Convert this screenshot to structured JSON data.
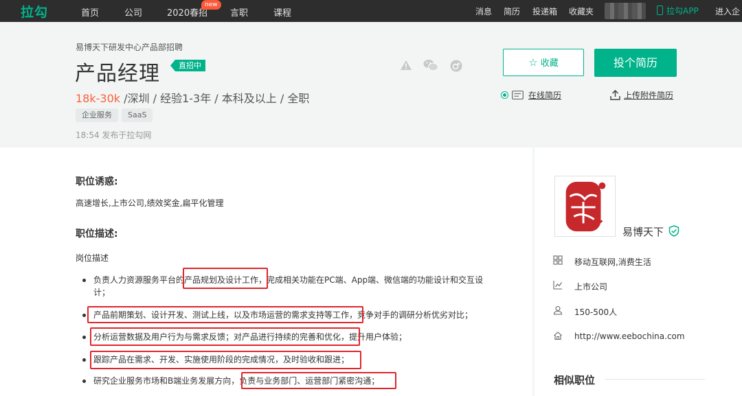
{
  "nav": {
    "logo": "拉勾",
    "items": [
      "首页",
      "公司",
      "2020春招",
      "言职",
      "课程"
    ],
    "new_badge": "new",
    "right_items": [
      "消息",
      "简历",
      "投递箱",
      "收藏夹"
    ],
    "app_label": "拉勾APP",
    "enterprise_label": "进入企"
  },
  "job": {
    "company_dept": "易博天下研发中心产品部招聘",
    "title": "产品经理",
    "badge": "直招中",
    "salary": "18k-30k",
    "meta": " /深圳 / 经验1-3年 / 本科及以上 / 全职",
    "tags": [
      "企业服务",
      "SaaS"
    ],
    "publish_time": "18:54  发布于拉勾网"
  },
  "actions": {
    "favorite": "收藏",
    "apply": "投个简历",
    "online_resume": "在线简历",
    "upload_resume": "上传附件简历"
  },
  "content": {
    "perks_title": "职位诱惑:",
    "perks": "高速增长,上市公司,绩效奖金,扁平化管理",
    "desc_title": "职位描述:",
    "desc_sub": "岗位描述",
    "bullets": [
      {
        "line1": "负责人力资源服务平台的产品规划及设计工作，完成相关功能在PC端、App端、微信端的功能设计和交互设",
        "line2": "计；"
      },
      {
        "line1": "产品前期策划、设计开发、测试上线，以及市场运营的需求支持等工作，竞争对手的调研分析优劣对比；"
      },
      {
        "line1": "分析运营数据及用户行为与需求反馈；对产品进行持续的完善和优化，提升用户体验；"
      },
      {
        "line1": "跟踪产品在需求、开发、实施使用阶段的完成情况，及时验收和跟进；"
      },
      {
        "line1": "研究企业服务市场和B端业务发展方向，负责与业务部门、运营部门紧密沟通；"
      }
    ]
  },
  "company": {
    "name": "易博天下",
    "field": "移动互联网,消费生活",
    "stage": "上市公司",
    "size": "150-500人",
    "site": "http://www.eebochina.com",
    "similar_title": "相似职位"
  },
  "colors": {
    "brand": "#00b38a",
    "salary": "#fd5f39",
    "highlight_box": "#e0242a"
  }
}
